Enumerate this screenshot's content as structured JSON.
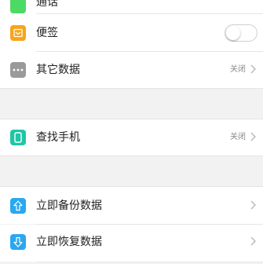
{
  "settings": {
    "partial_item": {
      "label": "通话",
      "icon": "phone-icon",
      "color": "#4cd964"
    },
    "notes": {
      "label": "便签",
      "icon": "notes-icon",
      "color": "#f7a51c",
      "toggle_on": false
    },
    "other_data": {
      "label": "其它数据",
      "icon": "more-icon",
      "color": "#9a9a9a",
      "status": "关闭"
    },
    "find_phone": {
      "label": "查找手机",
      "icon": "phone-locate-icon",
      "color": "#1fc6a6",
      "status": "关闭"
    },
    "backup_now": {
      "label": "立即备份数据",
      "icon": "upload-arrow-icon",
      "color": "#29a8f0"
    },
    "restore_now": {
      "label": "立即恢复数据",
      "icon": "download-arrow-icon",
      "color": "#29a8f0"
    }
  }
}
